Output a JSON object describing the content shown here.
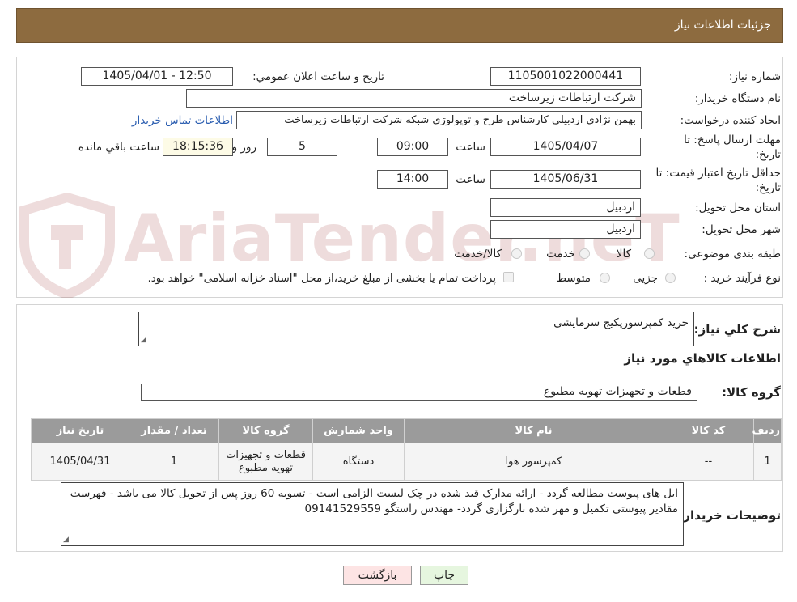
{
  "header": {
    "title": "جزئیات اطلاعات نیاز"
  },
  "labels": {
    "need_number": "شماره نیاز:",
    "announce_datetime": "تاریخ و ساعت اعلان عمومي:",
    "buyer_org": "نام دستگاه خریدار:",
    "requester": "ایجاد کننده درخواست:",
    "deadline_line1": "مهلت ارسال پاسخ: تا",
    "deadline_line2": "تاریخ:",
    "time_word": "ساعت",
    "day_and": "روز و",
    "remaining": "ساعت باقي مانده",
    "validity_line1": "حداقل تاریخ اعتبار قیمت: تا",
    "validity_line2": "تاریخ:",
    "delivery_province": "استان محل تحویل:",
    "delivery_city": "شهر محل تحویل:",
    "category": "طبقه بندی موضوعی:",
    "purchase_type": "نوع فرآیند خرید :",
    "general_desc": "شرح کلي نیاز:",
    "goods_info": "اطلاعات کالاهاي مورد نیاز",
    "goods_group": "گروه کالا:",
    "buyer_notes": "توضیحات خریدار:"
  },
  "values": {
    "need_number": "1105001022000441",
    "announce_datetime": "1405/04/01 - 12:50",
    "buyer_org": "شرکت ارتباطات زیرساخت",
    "requester": "بهمن نژادی اردبیلی کارشناس طرح و توپولوژی شبکه شرکت ارتباطات زیرساخت",
    "contact_link": "اطلاعات تماس خریدار",
    "deadline_date": "1405/04/07",
    "deadline_time": "09:00",
    "days_remaining": "5",
    "time_remaining": "18:15:36",
    "validity_date": "1405/06/31",
    "validity_time": "14:00",
    "province": "اردبیل",
    "city": "اردبیل",
    "general_desc": "خرید کمپرسورپکیج سرمایشی",
    "goods_group": "قطعات و تجهیزات تهویه مطبوع",
    "buyer_notes": "ایل های پیوست مطالعه گردد - ارائه مدارک قید شده در  چک لیست الزامی است - تسویه 60 روز پس از تحویل کالا می باشد - فهرست مقادیر پیوستی تکمیل و مهر شده بارگزاری گردد-  مهندس راستگو 09141529559"
  },
  "category_options": [
    "کالا",
    "خدمت",
    "کالا/خدمت"
  ],
  "purchase_options": [
    "جزیی",
    "متوسط"
  ],
  "treasury_note": "پرداخت تمام یا بخشی از مبلغ خرید،از محل \"اسناد خزانه اسلامی\" خواهد بود.",
  "table": {
    "headers": [
      "ردیف",
      "کد کالا",
      "نام کالا",
      "واحد شمارش",
      "گروه کالا",
      "تعداد / مقدار",
      "تاریخ نیاز"
    ],
    "rows": [
      [
        "1",
        "--",
        "کمپرسور هوا",
        "دستگاه",
        "قطعات و تجهیزات تهویه مطبوع",
        "1",
        "1405/04/31"
      ]
    ]
  },
  "buttons": {
    "print": "چاپ",
    "back": "بازگشت"
  },
  "watermark": "AriaTender.neT",
  "colors": {
    "header_bg": "#8d6b3f",
    "table_header_bg": "#9b9b9b",
    "back_btn_bg": "#fde4e4",
    "print_btn_bg": "#e6f6df"
  }
}
